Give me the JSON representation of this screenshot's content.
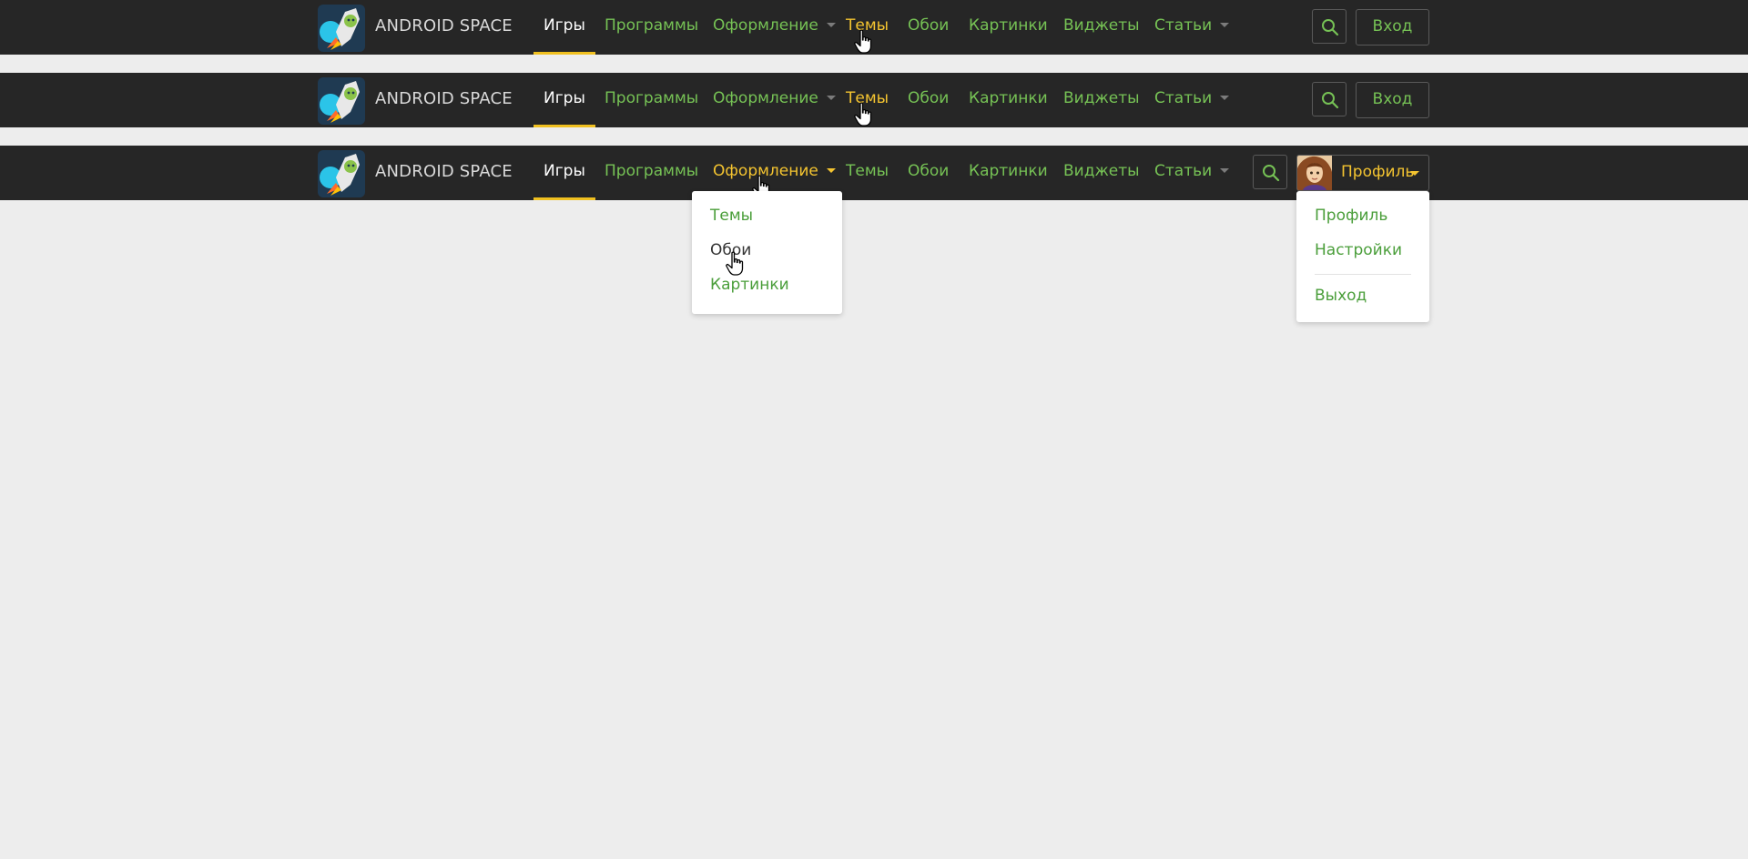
{
  "brand": {
    "name": "ANDROID SPACE",
    "logo_icon": "rocket-android-logo-icon"
  },
  "nav": {
    "items": [
      {
        "label": "Игры"
      },
      {
        "label": "Программы"
      },
      {
        "label": "Оформление"
      },
      {
        "label": "Темы"
      },
      {
        "label": "Обои"
      },
      {
        "label": "Картинки"
      },
      {
        "label": "Виджеты"
      },
      {
        "label": "Статьи"
      }
    ]
  },
  "navbars": [
    {
      "active_item": "Игры",
      "hovered_item": "Темы",
      "right_button": "Вход"
    },
    {
      "active_item": "Игры",
      "hovered_item": "Темы",
      "right_button": "Вход"
    },
    {
      "active_item": "Игры",
      "hovered_item": "Оформление",
      "right_button": "Профиль"
    }
  ],
  "search": {
    "icon": "search-icon"
  },
  "login": {
    "label": "Вход"
  },
  "profile": {
    "label": "Профиль",
    "avatar_icon": "user-avatar"
  },
  "decor_menu": {
    "items": [
      {
        "label": "Темы"
      },
      {
        "label": "Обои"
      },
      {
        "label": "Картинки"
      }
    ],
    "hovered_item": "Обои"
  },
  "profile_menu": {
    "items": [
      {
        "label": "Профиль"
      },
      {
        "label": "Настройки"
      },
      {
        "label": "Выход"
      }
    ]
  },
  "colors": {
    "navbar_bg": "#262626",
    "page_bg": "#ededed",
    "link_green": "#76c255",
    "hover_yellow": "#f4c430",
    "active_underline": "#f0c020",
    "dropdown_link": "#4a9e3a"
  }
}
